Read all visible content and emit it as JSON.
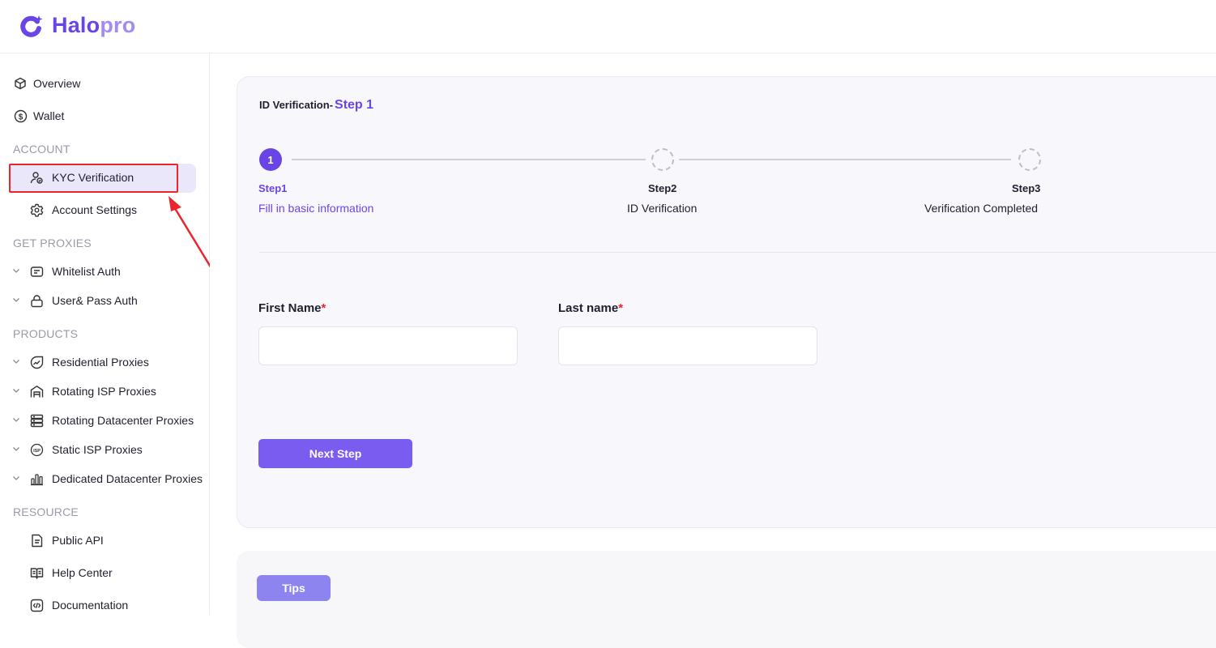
{
  "app": {
    "logo_part1": "Halo",
    "logo_part2": "pro"
  },
  "sidebar": {
    "top_items": [
      {
        "label": "Overview",
        "icon": "cube-icon"
      },
      {
        "label": "Wallet",
        "icon": "dollar-circle-icon"
      }
    ],
    "sections": [
      {
        "title": "ACCOUNT",
        "items": [
          {
            "label": "KYC Verification",
            "icon": "user-shield-icon",
            "active": true
          },
          {
            "label": "Account Settings",
            "icon": "gear-icon"
          }
        ]
      },
      {
        "title": "GET PROXIES",
        "items": [
          {
            "label": "Whitelist Auth",
            "icon": "list-card-icon",
            "expandable": true
          },
          {
            "label": "User& Pass Auth",
            "icon": "lock-icon",
            "expandable": true
          }
        ]
      },
      {
        "title": "PRODUCTS",
        "items": [
          {
            "label": "Residential Proxies",
            "icon": "trend-circle-icon",
            "expandable": true
          },
          {
            "label": "Rotating ISP Proxies",
            "icon": "building-icon",
            "expandable": true
          },
          {
            "label": "Rotating Datacenter Proxies",
            "icon": "server-icon",
            "expandable": true
          },
          {
            "label": "Static ISP Proxies",
            "icon": "isp-badge-icon",
            "expandable": true
          },
          {
            "label": "Dedicated Datacenter Proxies",
            "icon": "bars-icon",
            "expandable": true
          }
        ]
      },
      {
        "title": "RESOURCE",
        "items": [
          {
            "label": "Public API",
            "icon": "document-icon"
          },
          {
            "label": "Help Center",
            "icon": "book-icon"
          },
          {
            "label": "Documentation",
            "icon": "code-icon"
          }
        ]
      }
    ]
  },
  "main": {
    "title_prefix": "ID Verification-",
    "title_step": "Step 1",
    "steps": [
      {
        "number": "1",
        "label": "Step1",
        "sub": "Fill in basic information",
        "state": "active"
      },
      {
        "label": "Step2",
        "sub": "ID Verification",
        "state": "pending"
      },
      {
        "label": "Step3",
        "sub": "Verification Completed",
        "state": "pending"
      }
    ],
    "first_name": {
      "label": "First Name",
      "required_mark": "*",
      "value": "",
      "placeholder": ""
    },
    "last_name": {
      "label": "Last name",
      "required_mark": "*",
      "value": "",
      "placeholder": ""
    },
    "next_button": "Next Step",
    "tips_button": "Tips"
  },
  "colors": {
    "accent": "#6a45e6",
    "button": "#7a5cf0",
    "tips_button": "#8d84ef",
    "annotation_red": "#e8262b"
  }
}
